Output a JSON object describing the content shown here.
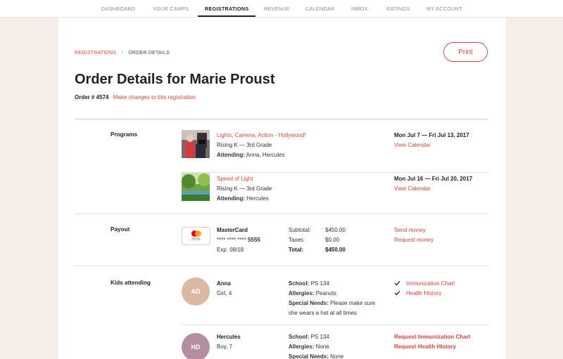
{
  "nav": {
    "items": [
      "DASHBOARD",
      "YOUR CAMPS",
      "REGISTRATIONS",
      "REVENUE",
      "CALENDAR",
      "INBOX",
      "RATINGS",
      "MY ACCOUNT"
    ],
    "active": "REGISTRATIONS"
  },
  "breadcrumb": {
    "parent": "REGISTRATIONS",
    "separator": "›",
    "current": "ORDER DETAILS"
  },
  "print_label": "Print",
  "title": "Order Details for Marie Proust",
  "order": {
    "number": "Order # 4574",
    "change_link": "Make changes to this registration"
  },
  "programs": {
    "label": "Programs",
    "items": [
      {
        "name": "Lights, Camera, Action - Hollywood!",
        "grade": "Rising K — 3rd Grade",
        "attending_label": "Attending:",
        "attending": "Anna, Hercules",
        "dates": "Mon Jul 7 — Fri Jul 13, 2017",
        "calendar_link": "View Calendar"
      },
      {
        "name": "Speed of Light",
        "grade": "Rising K — 3rd Grade",
        "attending_label": "Attending:",
        "attending": "Hercules",
        "dates": "Mon Jul 16 — Fri Jul 20, 2017",
        "calendar_link": "View Calendar"
      }
    ]
  },
  "payout": {
    "label": "Payout",
    "card_last4": "...5555",
    "card_type": "MasterCard",
    "card_masked": "**** **** ****",
    "card_number_end": "5555",
    "expiry": "Exp. 08/18",
    "subtotal_label": "Subtotal:",
    "subtotal": "$450.00",
    "taxes_label": "Taxes:",
    "taxes": "$0.00",
    "total_label": "Total:",
    "total": "$450.00",
    "send_money": "Send money",
    "request_money": "Request money"
  },
  "kids": {
    "label": "Kids attending",
    "items": [
      {
        "initials": "AD",
        "name": "Anna",
        "info": "Girl, 4",
        "school_label": "School:",
        "school": "PS 134",
        "allergies_label": "Allergies:",
        "allergies": "Peanuts",
        "special_label": "Special Needs:",
        "special_line1": "Please make sure",
        "special_line2": "she wears a hat at all times",
        "doc1": "Immunization Chart",
        "doc2": "Health History",
        "avatar_color": "#dbb9a1"
      },
      {
        "initials": "HD",
        "name": "Hercules",
        "info": "Boy, 7",
        "school_label": "School:",
        "school": "PS 134",
        "allergies_label": "Allergies:",
        "allergies": "None",
        "special_label": "Special Needs:",
        "special_line1": "None",
        "request1": "Request Immunization Chart",
        "request2": "Request Health History",
        "avatar_color": "#b48ea0"
      }
    ]
  },
  "colors": {
    "accent": "#d64545",
    "background": "#f4eee6"
  },
  "icons": {
    "mastercard": "mastercard-icon",
    "check": "check-icon",
    "breadcrumb_separator": "chevron-right-icon"
  }
}
